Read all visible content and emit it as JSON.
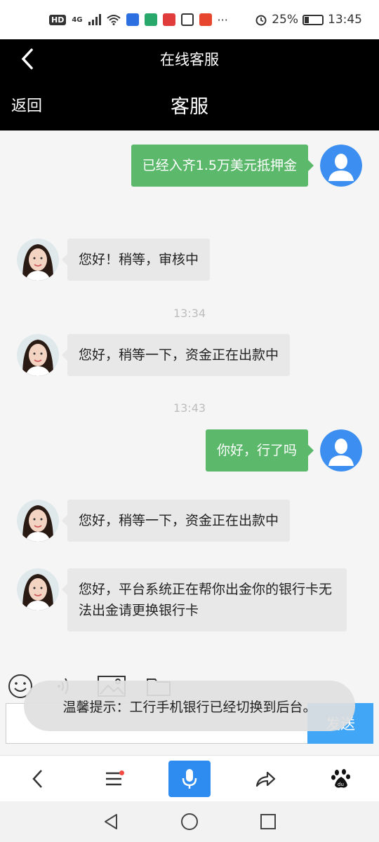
{
  "status_bar": {
    "hd_label": "HD",
    "signal_label": "4G",
    "more_label": "···",
    "battery_percent": "25%",
    "time": "13:45"
  },
  "header": {
    "title": "在线客服",
    "back_label": "返回",
    "sub_title": "客服"
  },
  "messages": [
    {
      "side": "out",
      "text": "已经入齐1.5万美元抵押金"
    },
    {
      "side": "in",
      "text": "您好！稍等，审核中"
    },
    {
      "side": "time",
      "text": "13:34"
    },
    {
      "side": "in",
      "text": "您好，稍等一下，资金正在出款中"
    },
    {
      "side": "time",
      "text": "13:43"
    },
    {
      "side": "out",
      "text": "你好，行了吗"
    },
    {
      "side": "in",
      "text": "您好，稍等一下，资金正在出款中"
    },
    {
      "side": "in",
      "text": "您好，平台系统正在帮你出金你的银行卡无法出金请更换银行卡"
    }
  ],
  "composer": {
    "send_label": "发送",
    "input_value": ""
  },
  "toast": {
    "text": "温馨提示：工行手机银行已经切换到后台。"
  },
  "icons": {
    "toolbar": [
      "emoji-icon",
      "voice-icon",
      "image-icon",
      "folder-icon"
    ],
    "browser": [
      "back-icon",
      "menu-icon",
      "mic-icon",
      "share-icon",
      "baidu-icon"
    ],
    "nav": [
      "nav-back-icon",
      "nav-home-icon",
      "nav-recent-icon"
    ]
  },
  "colors": {
    "outgoing_bubble": "#5cb96b",
    "incoming_bubble": "#e8e8e8",
    "header_bg": "#000000",
    "send_button": "#41a6f5",
    "mic_button": "#2e8bf0"
  }
}
